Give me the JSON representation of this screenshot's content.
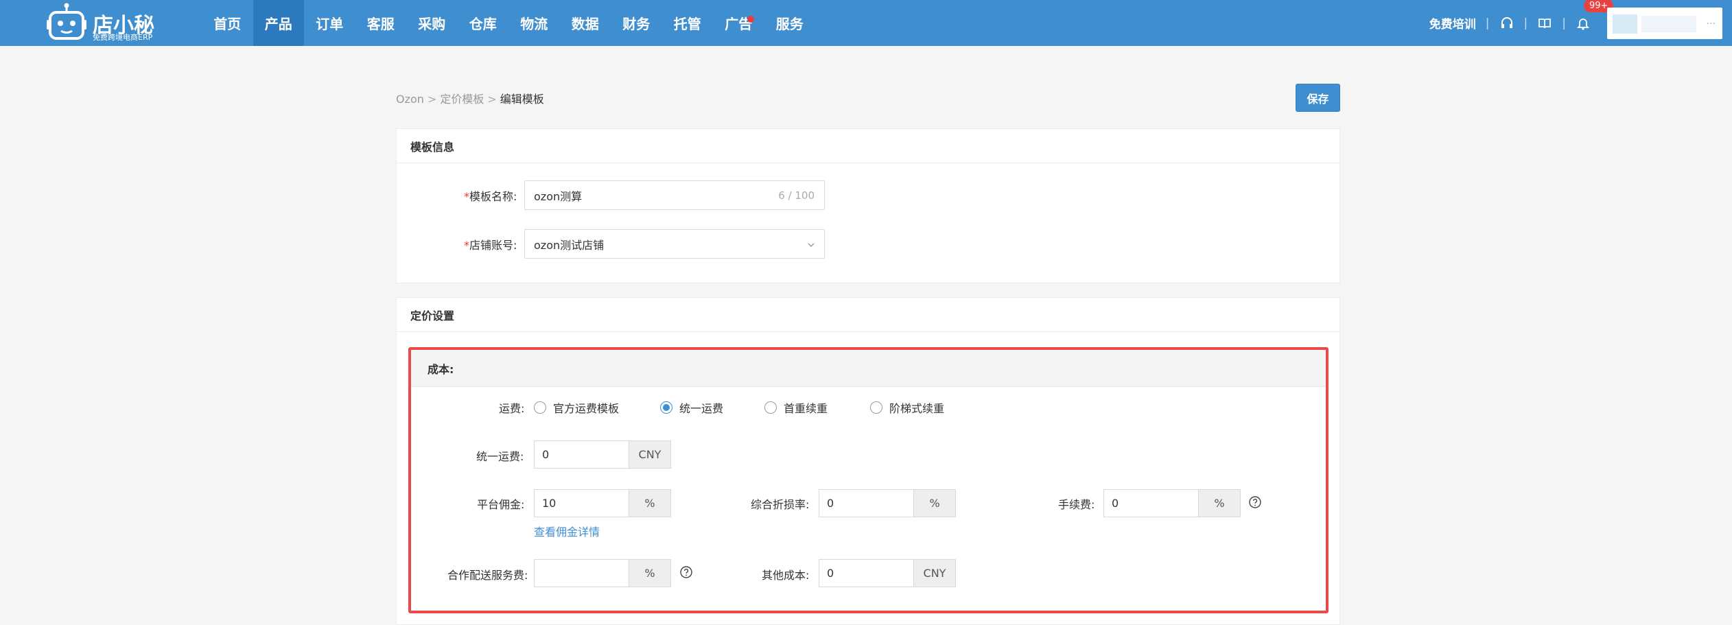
{
  "header": {
    "logo_text": "店小秘",
    "logo_sub": "免费跨境电商ERP",
    "nav": [
      "首页",
      "产品",
      "订单",
      "客服",
      "采购",
      "仓库",
      "物流",
      "数据",
      "财务",
      "托管",
      "广告",
      "服务"
    ],
    "active_nav": "产品",
    "training": "免费培训",
    "badge": "99+",
    "user_ellipsis": "..."
  },
  "breadcrumb": {
    "root": "Ozon",
    "parent": "定价模板",
    "current": "编辑模板",
    "sep": ">"
  },
  "save_label": "保存",
  "info": {
    "title": "模板信息",
    "name_label": "模板名称:",
    "name_value": "ozon测算",
    "name_counter": "6 / 100",
    "shop_label": "店铺账号:",
    "shop_value": "ozon测试店铺",
    "required_mark": "*"
  },
  "pricing": {
    "title": "定价设置",
    "cost": {
      "title": "成本:",
      "shipping_label": "运费:",
      "shipping_options": [
        "官方运费模板",
        "统一运费",
        "首重续重",
        "阶梯式续重"
      ],
      "shipping_selected": "统一运费",
      "uniform_label": "统一运费:",
      "uniform_value": "0",
      "uniform_unit": "CNY",
      "commission_label": "平台佣金:",
      "commission_value": "10",
      "commission_unit": "%",
      "commission_link": "查看佣金详情",
      "discount_label": "综合折损率:",
      "discount_value": "0",
      "discount_unit": "%",
      "fee_label": "手续费:",
      "fee_value": "0",
      "fee_unit": "%",
      "delivery_label": "合作配送服务费:",
      "delivery_value": "",
      "delivery_unit": "%",
      "other_label": "其他成本:",
      "other_value": "0",
      "other_unit": "CNY"
    }
  },
  "colors": {
    "brand": "#3f8ed0",
    "highlight": "#e94b4b",
    "badge": "#e94040"
  }
}
